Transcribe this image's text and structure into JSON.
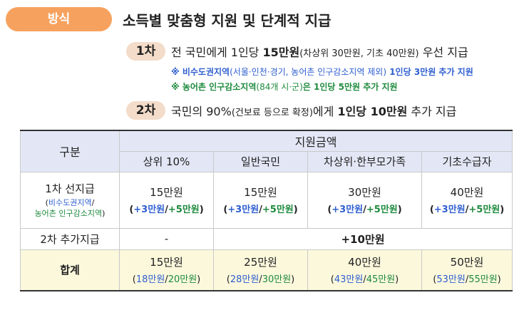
{
  "section": {
    "pill": "방식",
    "heading": "소득별 맞춤형 지원 및 단계적 지급"
  },
  "round1": {
    "badge": "1차",
    "pre": "전 국민에게 1인당 ",
    "bold": "15만원",
    "paren": "(차상위 30만원, 기초 40만원)",
    "post": " 우선 지급",
    "note1_a": "※ 비수도권지역",
    "note1_b": "(서울·인천·경기, 농어촌 인구감소지역 제외)",
    "note1_c": " 1인당 3만원 추가 지원",
    "note2_a": "※ 농어촌 인구감소지역",
    "note2_b": "(84개 시·군)",
    "note2_c": "은 1인당 5만원 추가 지원"
  },
  "round2": {
    "badge": "2차",
    "pre": "국민의 90%",
    "paren": "(건보료 등으로 확정)",
    "mid": "에게 ",
    "bold": "1인당 10만원",
    "post": " 추가 지급"
  },
  "table": {
    "col_head": "구분",
    "group_head": "지원금액",
    "columns": [
      "상위 10%",
      "일반국민",
      "차상위·한부모가족",
      "기초수급자"
    ],
    "row1": {
      "label": "1차 선지급",
      "sub_open": "(",
      "sub_blue": "비수도권지역",
      "sub_slash": "/",
      "sub_green": "농어촌 인구감소지역",
      "sub_close": ")",
      "cells": [
        {
          "amount": "15만원",
          "open": "(",
          "blue": "+3만원",
          "slash": "/",
          "green": "+5만원",
          "close": ")"
        },
        {
          "amount": "15만원",
          "open": "(",
          "blue": "+3만원",
          "slash": "/",
          "green": "+5만원",
          "close": ")"
        },
        {
          "amount": "30만원",
          "open": "(",
          "blue": "+3만원",
          "slash": "/",
          "green": "+5만원",
          "close": ")"
        },
        {
          "amount": "40만원",
          "open": "(",
          "blue": "+3만원",
          "slash": "/",
          "green": "+5만원",
          "close": ")"
        }
      ]
    },
    "row2": {
      "label": "2차 추가지급",
      "top10": "-",
      "others": "+10만원"
    },
    "row3": {
      "label": "합계",
      "cells": [
        {
          "amount": "15만원",
          "open": "(",
          "blue": "18만원",
          "slash": "/",
          "green": "20만원",
          "close": ")"
        },
        {
          "amount": "25만원",
          "open": "(",
          "blue": "28만원",
          "slash": "/",
          "green": "30만원",
          "close": ")"
        },
        {
          "amount": "40만원",
          "open": "(",
          "blue": "43만원",
          "slash": "/",
          "green": "45만원",
          "close": ")"
        },
        {
          "amount": "50만원",
          "open": "(",
          "blue": "53만원",
          "slash": "/",
          "green": "55만원",
          "close": ")"
        }
      ]
    }
  },
  "colors": {
    "pill": "#f6a25e",
    "badge": "#f3dcc9",
    "header": "#e3e7f5",
    "total_row": "#fbf8dc",
    "blue": "#2f5fd0",
    "green": "#1e8a3e"
  }
}
